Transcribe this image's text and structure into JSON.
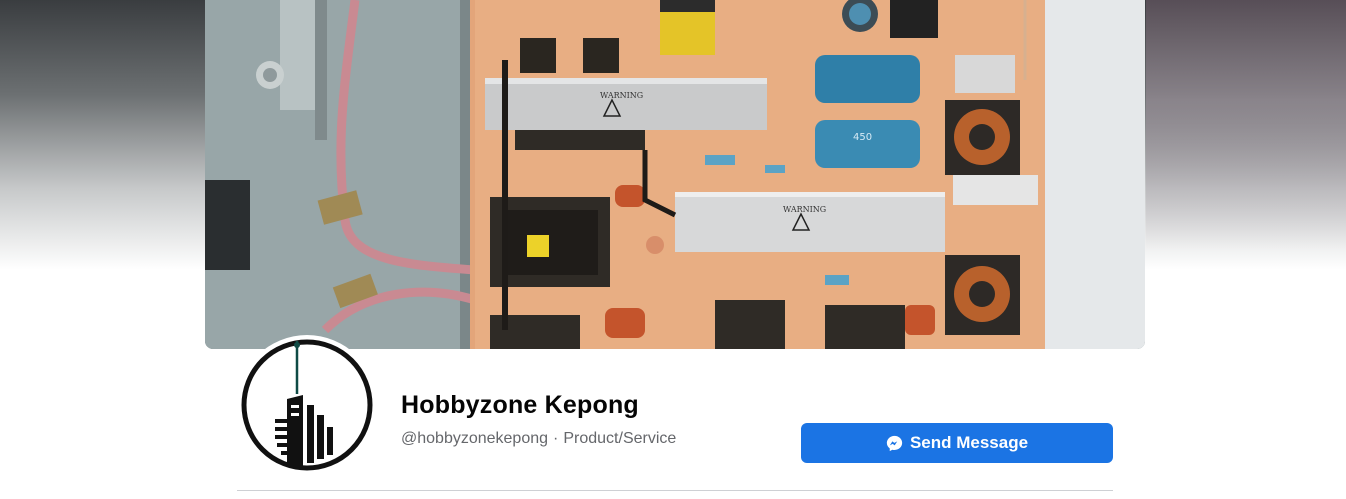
{
  "page": {
    "name": "Hobbyzone Kepong",
    "username": "@hobbyzonekepong",
    "separator": "·",
    "category": "Product/Service"
  },
  "cover": {
    "warning_label_1": "WARNING",
    "warning_label_2": "WARNING",
    "capacitor_label": "450"
  },
  "actions": {
    "send_message_label": "Send Message",
    "send_message_icon": "messenger-icon"
  },
  "colors": {
    "button_blue": "#1b74e4",
    "text_primary": "#050505",
    "text_secondary": "#65676b",
    "logo_teal": "#0f4a45"
  }
}
